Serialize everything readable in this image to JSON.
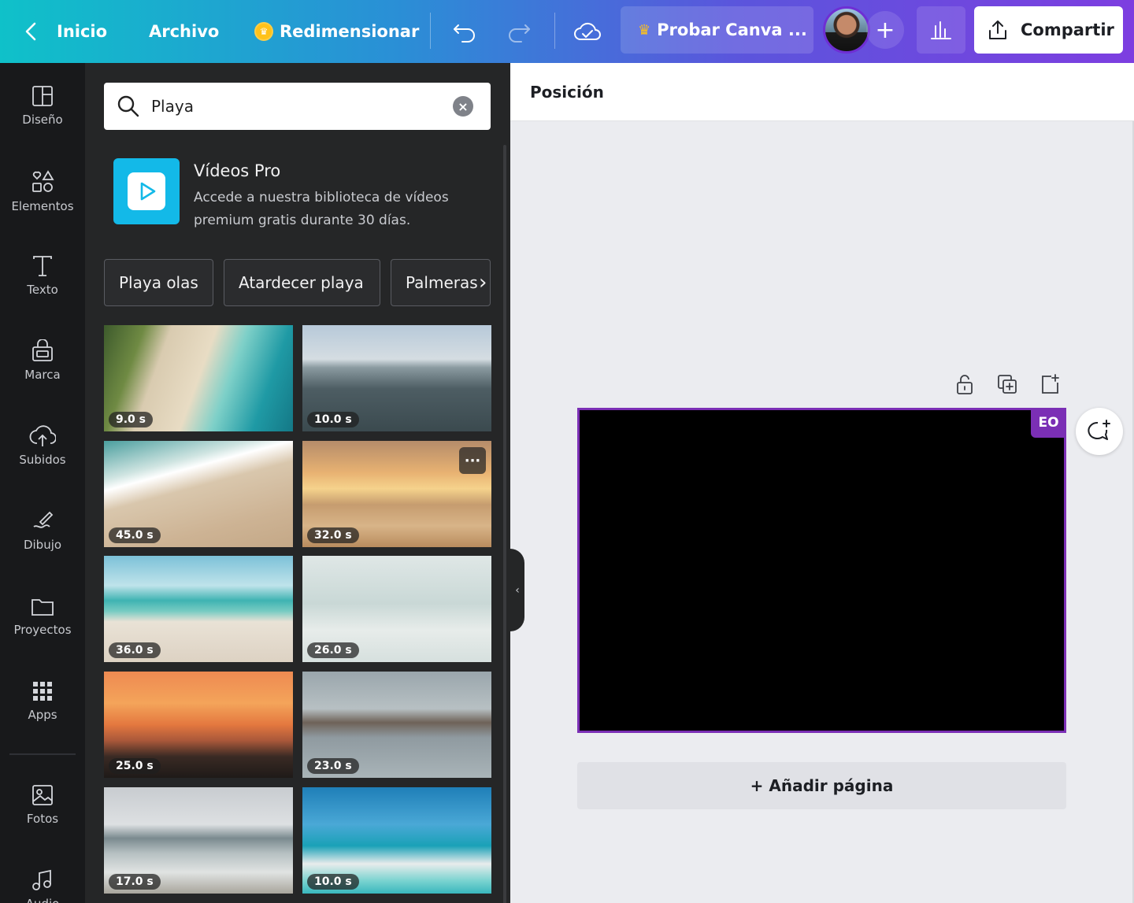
{
  "topbar": {
    "back_icon": "chevron-left-icon",
    "home": "Inicio",
    "file": "Archivo",
    "resize": "Redimensionar",
    "try_canva": "Probar Canva ...",
    "share": "Compartir"
  },
  "rail": {
    "items": [
      {
        "label": "Diseño",
        "icon": "layout-icon"
      },
      {
        "label": "Elementos",
        "icon": "shapes-icon"
      },
      {
        "label": "Texto",
        "icon": "text-icon"
      },
      {
        "label": "Marca",
        "icon": "brand-icon"
      },
      {
        "label": "Subidos",
        "icon": "cloud-upload-icon"
      },
      {
        "label": "Dibujo",
        "icon": "draw-icon"
      },
      {
        "label": "Proyectos",
        "icon": "folder-icon"
      },
      {
        "label": "Apps",
        "icon": "grid-icon"
      },
      {
        "label": "Fotos",
        "icon": "image-icon"
      },
      {
        "label": "Audio",
        "icon": "music-icon"
      }
    ]
  },
  "panel": {
    "search_value": "Playa",
    "promo_title": "Vídeos Pro",
    "promo_desc": "Accede a nuestra biblioteca de vídeos premium gratis durante 30 días.",
    "chips": [
      "Playa olas",
      "Atardecer playa",
      "Palmeras"
    ],
    "videos": [
      {
        "duration": "9.0 s"
      },
      {
        "duration": "10.0 s"
      },
      {
        "duration": "45.0 s"
      },
      {
        "duration": "32.0 s"
      },
      {
        "duration": "36.0 s"
      },
      {
        "duration": "26.0 s"
      },
      {
        "duration": "25.0 s"
      },
      {
        "duration": "23.0 s"
      },
      {
        "duration": "17.0 s"
      },
      {
        "duration": "10.0 s"
      }
    ]
  },
  "workspace": {
    "toolbar_label": "Posición",
    "canvas_badge": "EO",
    "add_page": "+ Añadir página"
  }
}
